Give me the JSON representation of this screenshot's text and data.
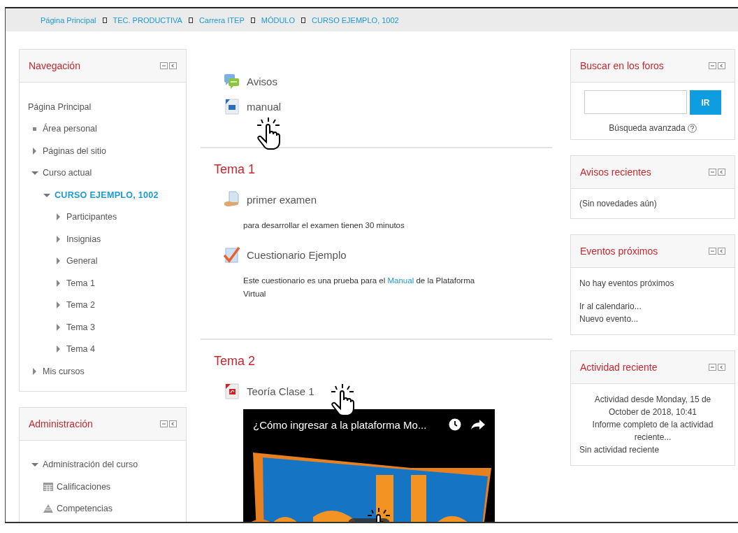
{
  "breadcrumb": [
    {
      "label": "Página Principal"
    },
    {
      "label": "TEC. PRODUCTIVA"
    },
    {
      "label": "Carrera ITEP"
    },
    {
      "label": "MÓDULO"
    },
    {
      "label": "CURSO EJEMPLO, 1002"
    }
  ],
  "left_blocks": [
    {
      "title": "Navegación",
      "tree": [
        {
          "label": "Página Principal",
          "kind": "plain",
          "selected": false
        },
        {
          "label": "Área personal",
          "kind": "bullet",
          "selected": false
        },
        {
          "label": "Páginas del sitio",
          "kind": "branch",
          "expanded": false,
          "selected": false
        },
        {
          "label": "Curso actual",
          "kind": "branch",
          "expanded": true,
          "selected": false,
          "children": [
            {
              "label": "CURSO EJEMPLO, 1002",
              "kind": "branch",
              "expanded": true,
              "selected": true,
              "children": [
                {
                  "label": "Participantes",
                  "kind": "branch",
                  "expanded": false,
                  "selected": false
                },
                {
                  "label": "Insignias",
                  "kind": "branch",
                  "expanded": false,
                  "selected": false
                },
                {
                  "label": "General",
                  "kind": "branch",
                  "expanded": false,
                  "selected": false
                },
                {
                  "label": "Tema 1",
                  "kind": "branch",
                  "expanded": false,
                  "selected": false
                },
                {
                  "label": "Tema 2",
                  "kind": "branch",
                  "expanded": false,
                  "selected": false
                },
                {
                  "label": "Tema 3",
                  "kind": "branch",
                  "expanded": false,
                  "selected": false
                },
                {
                  "label": "Tema 4",
                  "kind": "branch",
                  "expanded": false,
                  "selected": false
                }
              ]
            }
          ]
        },
        {
          "label": "Mis cursos",
          "kind": "branch",
          "expanded": false,
          "selected": false
        }
      ]
    },
    {
      "title": "Administración",
      "tree": [
        {
          "label": "Administración del curso",
          "kind": "branch",
          "expanded": true,
          "selected": false,
          "children": [
            {
              "label": "Calificaciones",
              "kind": "gradebook",
              "selected": false
            },
            {
              "label": "Competencias",
              "kind": "competency",
              "selected": false
            }
          ]
        }
      ]
    }
  ],
  "sections": [
    {
      "activities": [
        {
          "kind": "forum",
          "name": "Avisos"
        },
        {
          "kind": "word",
          "name": "manual"
        }
      ]
    },
    {
      "title": "Tema 1",
      "activities": [
        {
          "kind": "assignment",
          "name": "primer examen",
          "description": [
            {
              "kind": "text",
              "text": "para desarrollar el examen tienen 30 minutos"
            }
          ]
        },
        {
          "kind": "quiz",
          "name": "Cuestionario Ejemplo",
          "description": [
            {
              "kind": "text",
              "text": "Este cuestionario es una prueba para el "
            },
            {
              "kind": "link",
              "text": "Manual"
            },
            {
              "kind": "text",
              "text": " de la Plataforma Virtual"
            }
          ]
        }
      ]
    },
    {
      "title": "Tema 2",
      "activities": [
        {
          "kind": "pdf",
          "name": "Teoría Clase 1"
        },
        {
          "kind": "video",
          "name": "¿Cómo ingresar a la plataforma Mo..."
        }
      ]
    }
  ],
  "right_blocks": [
    {
      "kind": "search",
      "title": "Buscar en los foros",
      "button": "IR",
      "link": "Búsqueda avanzada"
    },
    {
      "kind": "list",
      "title": "Avisos recientes",
      "lines": [
        {
          "kind": "text",
          "text": "(Sin novedades aún)"
        }
      ]
    },
    {
      "kind": "list",
      "title": "Eventos próximos",
      "lines": [
        {
          "kind": "text",
          "text": "No hay eventos próximos"
        },
        {
          "kind": "link",
          "text": "Ir al calendario..."
        },
        {
          "kind": "link",
          "text": "Nuevo evento..."
        }
      ]
    },
    {
      "kind": "list",
      "title": "Actividad reciente",
      "lines": [
        {
          "kind": "center-text",
          "text": "Actividad desde Monday, 15 de October de 2018, 10:41"
        },
        {
          "kind": "center-link",
          "text": "Informe completo de la actividad reciente..."
        },
        {
          "kind": "text",
          "text": "Sin actividad reciente"
        }
      ]
    }
  ]
}
